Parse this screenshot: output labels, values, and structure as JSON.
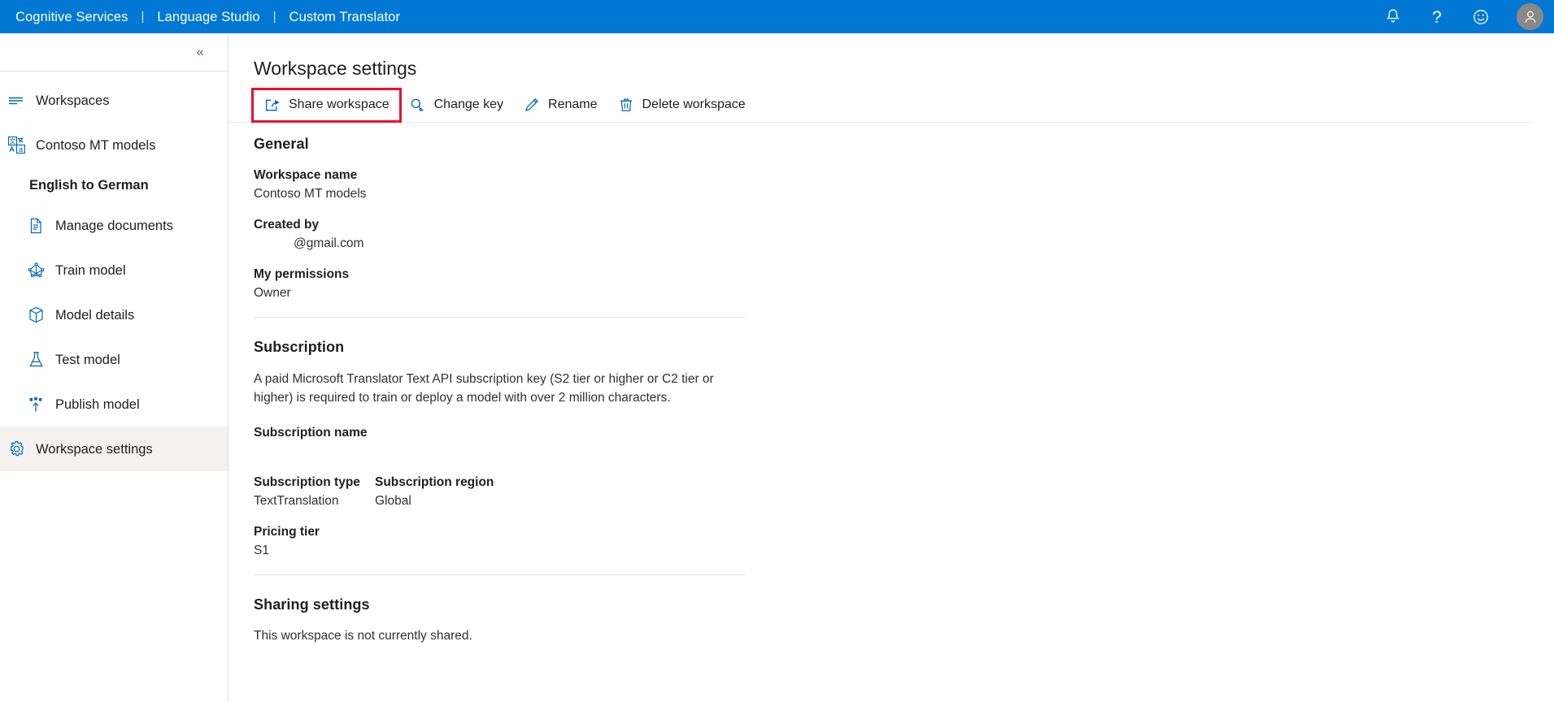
{
  "topbar": {
    "links": [
      {
        "label": "Cognitive Services",
        "name": "cognitive-services-link"
      },
      {
        "label": "Language Studio",
        "name": "language-studio-link"
      },
      {
        "label": "Custom Translator",
        "name": "custom-translator-link"
      }
    ],
    "separator": "|",
    "icons": [
      {
        "name": "notification-bell-icon",
        "label": "Notifications"
      },
      {
        "name": "help-question-icon",
        "label": "Help"
      },
      {
        "name": "feedback-smiley-icon",
        "label": "Feedback"
      },
      {
        "name": "user-avatar",
        "label": "Account"
      }
    ],
    "brand_color": "#0078d4",
    "avatar_color": "#8a8886"
  },
  "sidebar": {
    "collapse_glyph": "«",
    "items": [
      {
        "label": "Workspaces",
        "icon": "list-lines-icon",
        "level": 0,
        "selected": false
      },
      {
        "label": "Contoso MT models",
        "icon": "translate-icon",
        "level": 0,
        "selected": false
      },
      {
        "label": "English to German",
        "icon": "none",
        "level": 0,
        "selected": false,
        "bold": true
      },
      {
        "label": "Manage documents",
        "icon": "document-icon",
        "level": 1,
        "selected": false
      },
      {
        "label": "Train model",
        "icon": "train-network-icon",
        "level": 1,
        "selected": false
      },
      {
        "label": "Model details",
        "icon": "cube-box-icon",
        "level": 1,
        "selected": false
      },
      {
        "label": "Test model",
        "icon": "flask-icon",
        "level": 1,
        "selected": false
      },
      {
        "label": "Publish model",
        "icon": "publish-upload-icon",
        "level": 1,
        "selected": false
      },
      {
        "label": "Workspace settings",
        "icon": "gear-icon",
        "level": 0,
        "selected": true
      }
    ],
    "selected_bg": "#f3f2f1"
  },
  "main": {
    "title": "Workspace settings",
    "commands": [
      {
        "label": "Share workspace",
        "icon": "share-arrow-icon",
        "highlighted": true
      },
      {
        "label": "Change key",
        "icon": "key-icon",
        "highlighted": false
      },
      {
        "label": "Rename",
        "icon": "pencil-icon",
        "highlighted": false
      },
      {
        "label": "Delete workspace",
        "icon": "trash-icon",
        "highlighted": false
      }
    ],
    "highlight_color": "#e8112d",
    "sections": {
      "general": {
        "heading": "General",
        "workspace_name_label": "Workspace name",
        "workspace_name_value": "Contoso MT models",
        "created_by_label": "Created by",
        "created_by_value": "@gmail.com",
        "permissions_label": "My permissions",
        "permissions_value": "Owner"
      },
      "subscription": {
        "heading": "Subscription",
        "description": "A paid Microsoft Translator Text API subscription key (S2 tier or higher or C2 tier or higher) is required to train or deploy a model with over 2 million characters.",
        "name_label": "Subscription name",
        "name_value": "",
        "type_label": "Subscription type",
        "type_value": "TextTranslation",
        "region_label": "Subscription region",
        "region_value": "Global",
        "pricing_label": "Pricing tier",
        "pricing_value": "S1"
      },
      "sharing": {
        "heading": "Sharing settings",
        "status": "This workspace is not currently shared."
      }
    }
  }
}
